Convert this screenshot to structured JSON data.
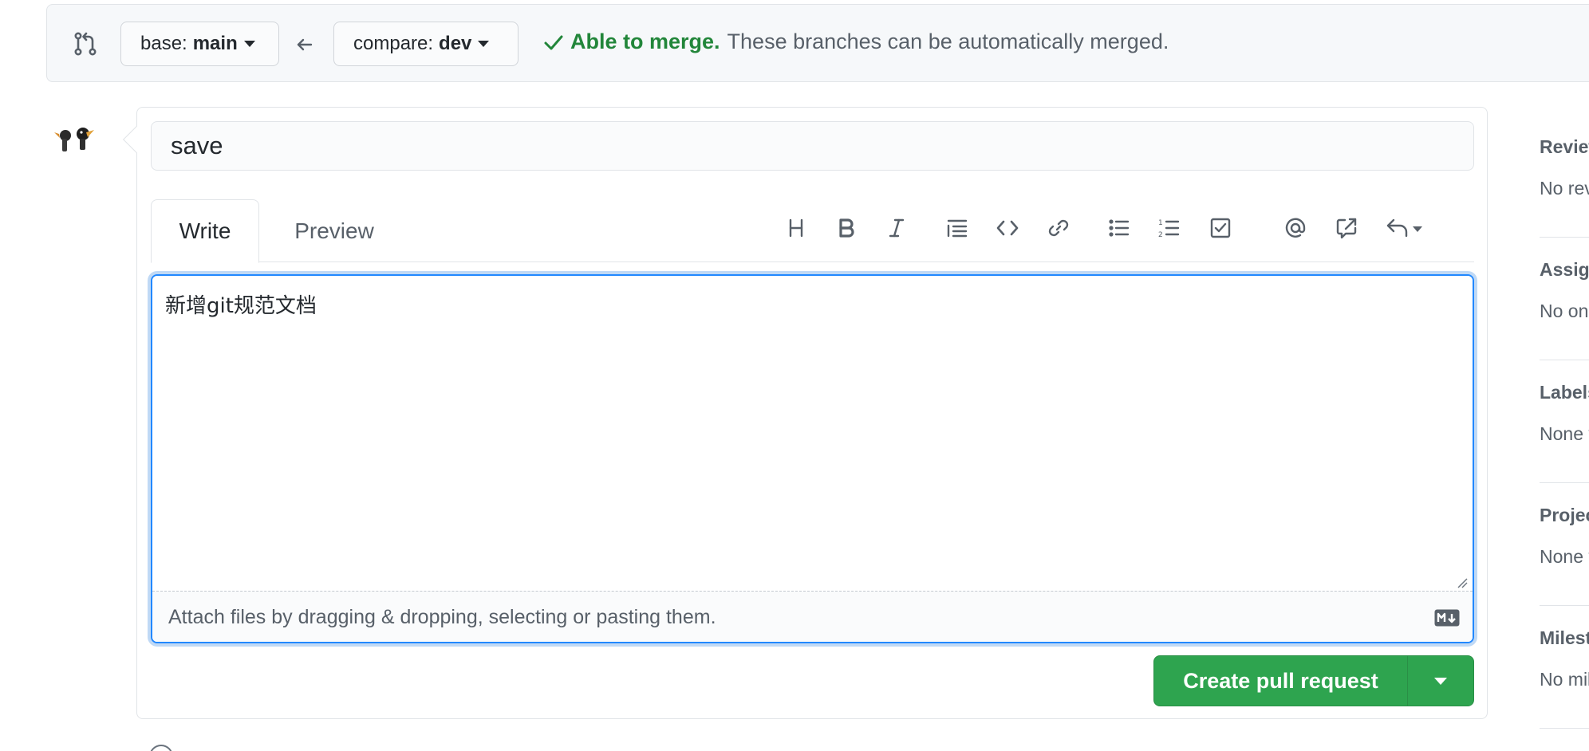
{
  "compare_bar": {
    "base_label": "base:",
    "base_branch": "main",
    "compare_label": "compare:",
    "compare_branch": "dev",
    "merge_ok": "Able to merge.",
    "merge_desc": "These branches can be automatically merged."
  },
  "pr": {
    "title_value": "save",
    "tabs": [
      {
        "label": "Write",
        "active": true
      },
      {
        "label": "Preview",
        "active": false
      }
    ],
    "toolbar_icons": [
      "heading-icon",
      "bold-icon",
      "italic-icon",
      "quote-icon",
      "code-icon",
      "link-icon",
      "bullet-list-icon",
      "numbered-list-icon",
      "task-list-icon",
      "mention-icon",
      "reference-icon",
      "reply-icon"
    ],
    "body_value": "新增git规范文档",
    "attach_text": "Attach files by dragging & dropping, selecting or pasting them.",
    "create_label": "Create pull request"
  },
  "sidebar": {
    "items": [
      {
        "heading": "Reviewers",
        "value": "No reviews"
      },
      {
        "heading": "Assignees",
        "value": "No one"
      },
      {
        "heading": "Labels",
        "value": "None yet"
      },
      {
        "heading": "Projects",
        "value": "None yet"
      },
      {
        "heading": "Milestone",
        "value": "No milestone"
      }
    ]
  },
  "colors": {
    "accent_green": "#2ea44f",
    "merge_text_green": "#22863a",
    "focus_blue": "#2188ff"
  }
}
